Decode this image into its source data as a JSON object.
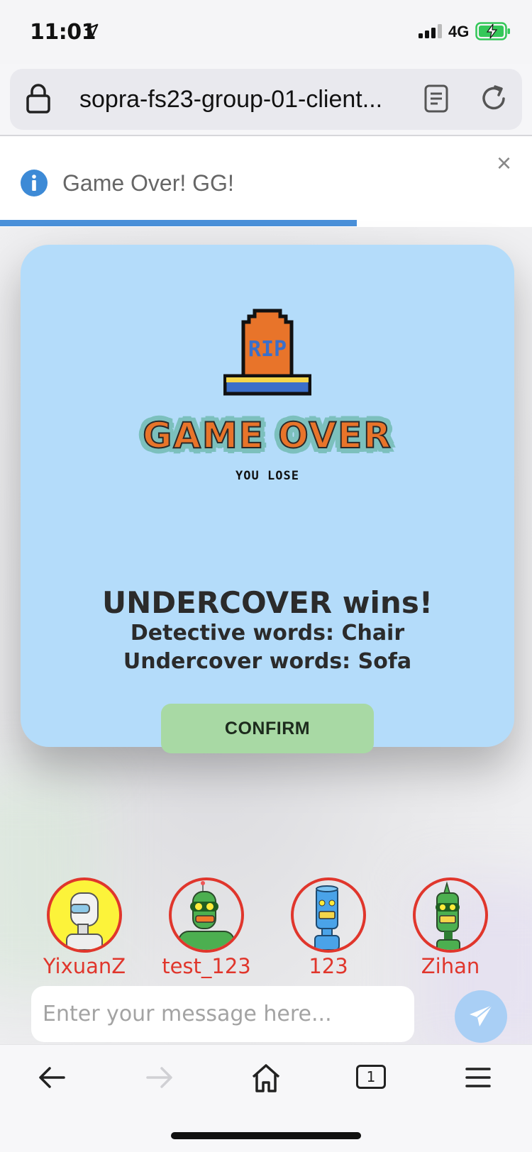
{
  "status_bar": {
    "time": "11:01",
    "network": "4G",
    "battery_level": 0.85,
    "battery_color": "#34c759"
  },
  "browser": {
    "url": "sopra-fs23-group-01-client...",
    "tab_count": "1"
  },
  "toast": {
    "message": "Game Over! GG!",
    "close_label": "×",
    "progress": 0.67
  },
  "modal": {
    "banner_title": "GAME OVER",
    "banner_subtitle": "YOU LOSE",
    "tombstone_text": "RIP",
    "winner_text": "UNDERCOVER wins!",
    "detective_words": "Detective words: Chair",
    "undercover_words": "Undercover words: Sofa",
    "confirm_label": "CONFIRM"
  },
  "players": [
    {
      "name": "YixuanZ",
      "avatar": "white-robot-avatar",
      "bg": "#fcf33a"
    },
    {
      "name": "test_123",
      "avatar": "green-robot-antenna-avatar",
      "bg": "transparent"
    },
    {
      "name": "123",
      "avatar": "blue-robot-avatar",
      "bg": "transparent"
    },
    {
      "name": "Zihan",
      "avatar": "green-robot-spike-avatar",
      "bg": "transparent"
    }
  ],
  "chat": {
    "placeholder": "Enter your message here..."
  },
  "colors": {
    "modal_bg": "#b4dcfa",
    "confirm_bg": "#a8d9a4",
    "player_accent": "#e0362c",
    "title_orange": "#e8742a"
  }
}
